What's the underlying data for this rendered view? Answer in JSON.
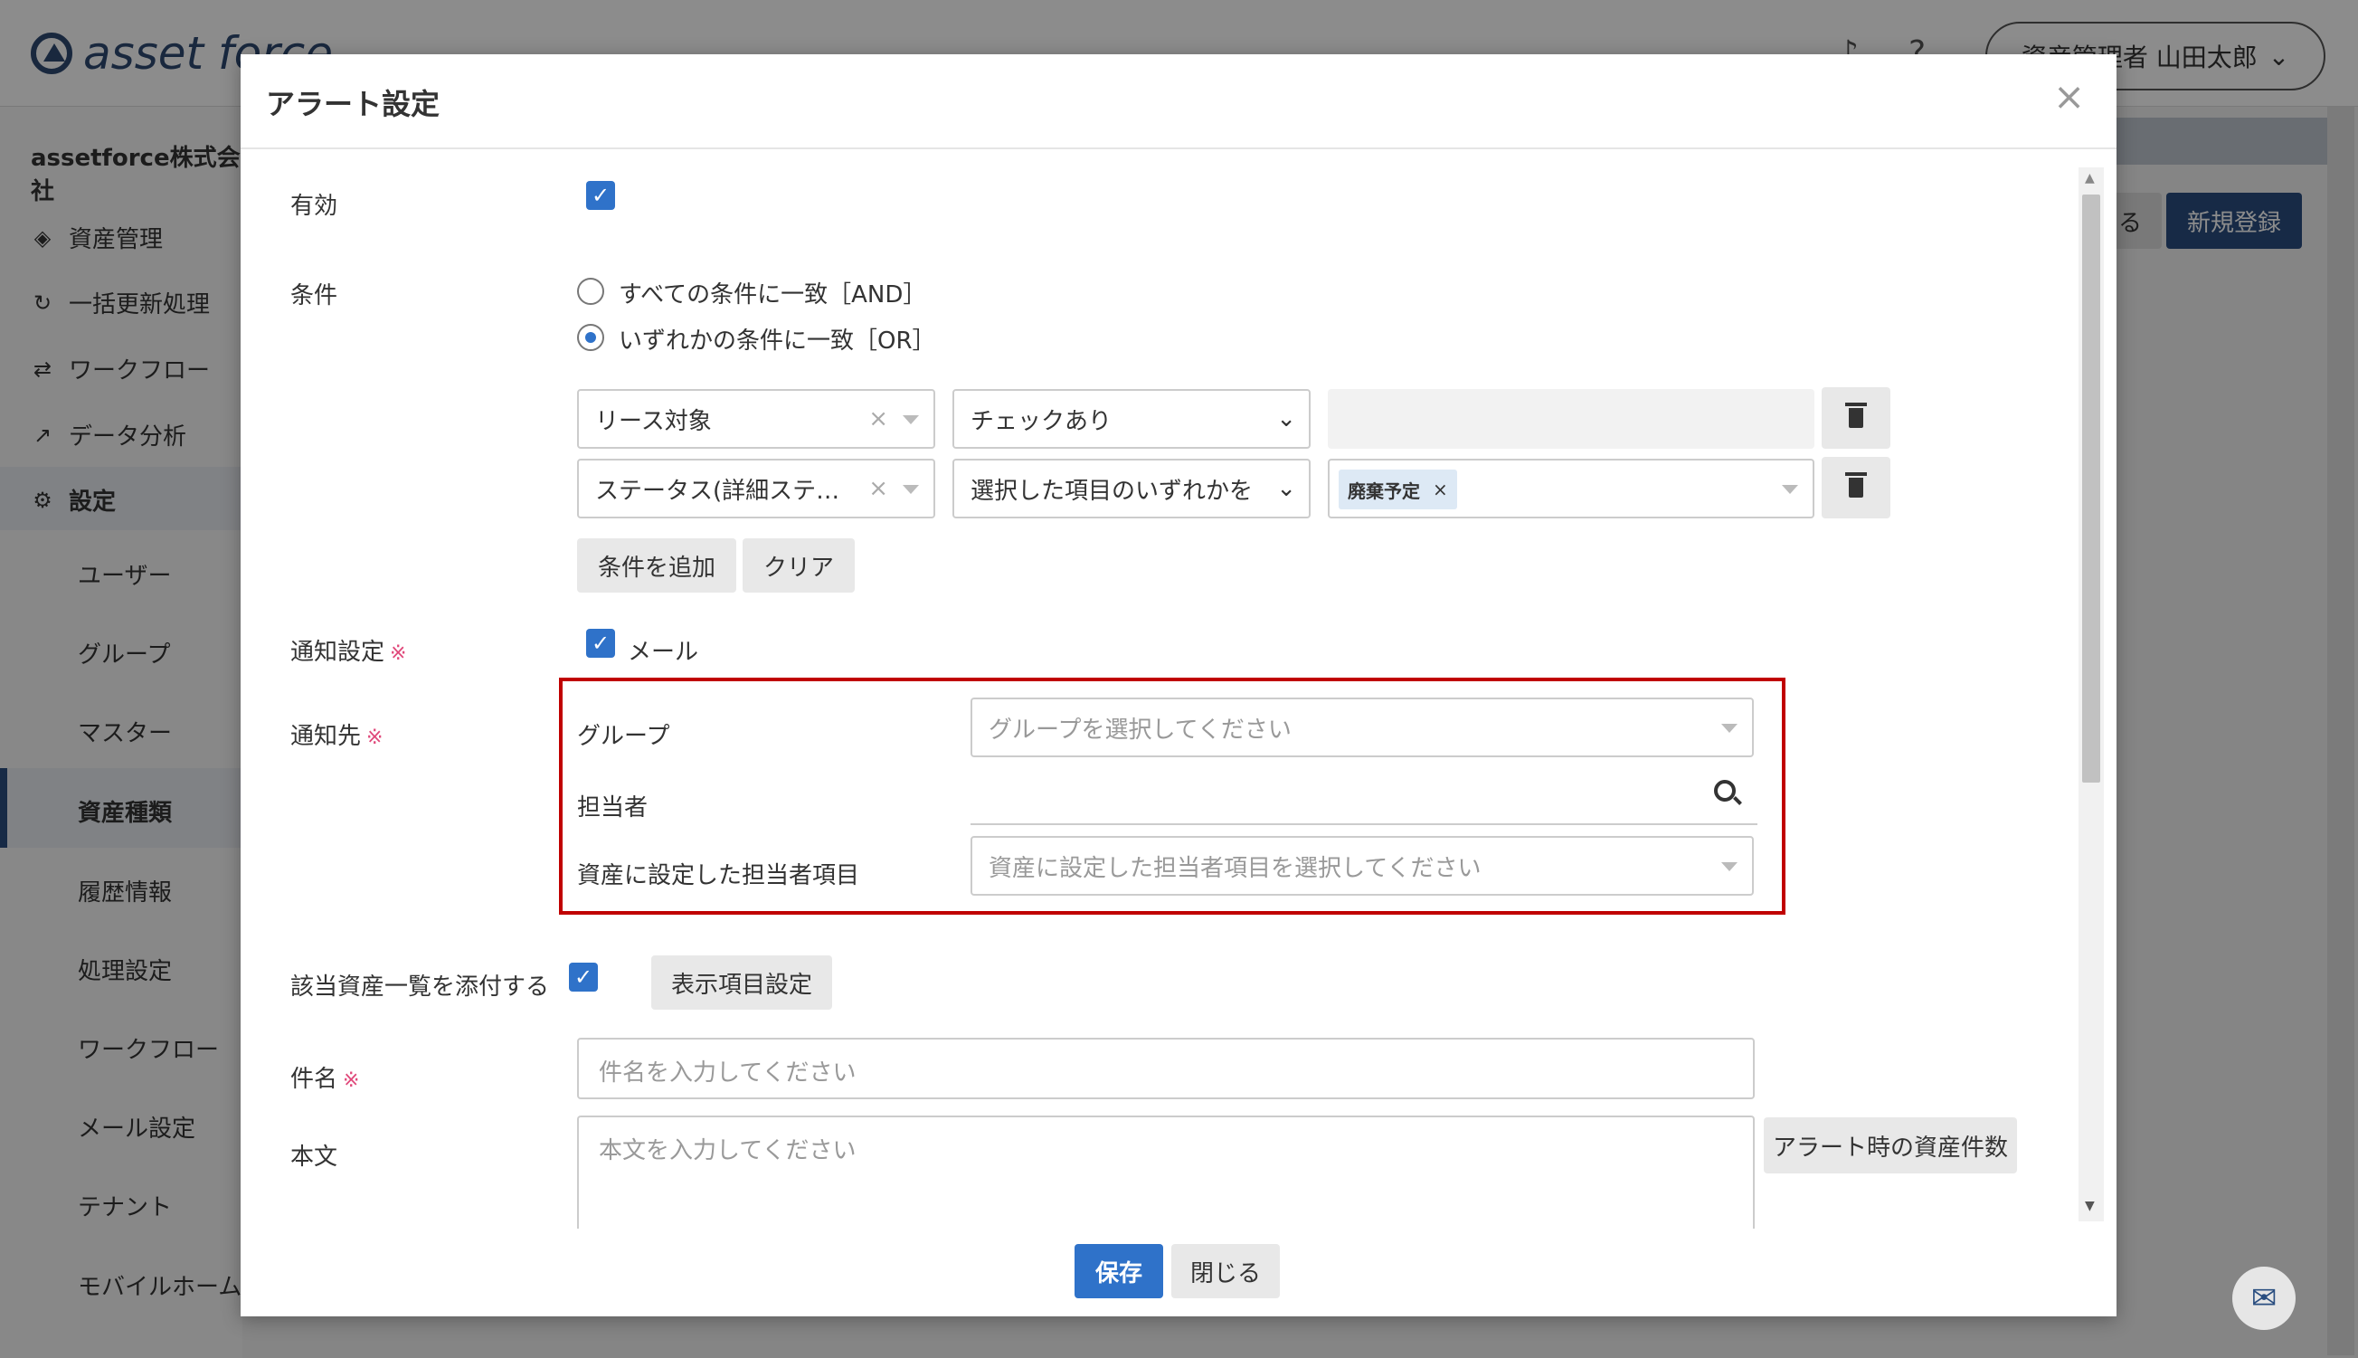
{
  "app": {
    "logo": "asset force",
    "user_label": "資産管理者 山田太郎",
    "company": "assetforce株式会社",
    "nav": [
      {
        "label": "資産管理",
        "icon": "cube-icon"
      },
      {
        "label": "一括更新処理",
        "icon": "refresh-icon"
      },
      {
        "label": "ワークフロー",
        "icon": "workflow-icon"
      },
      {
        "label": "データ分析",
        "icon": "chart-icon"
      },
      {
        "label": "設定",
        "icon": "gear-icon"
      }
    ],
    "subnav": [
      "ユーザー",
      "グループ",
      "マスター",
      "資産種類",
      "履歴情報",
      "処理設定",
      "ワークフロー",
      "メール設定",
      "テナント",
      "モバイルホーム"
    ],
    "bg_button_partial": "る",
    "bg_button_new": "新規登録"
  },
  "modal": {
    "title": "アラート設定",
    "close": "×",
    "enabled_label": "有効",
    "condition_label": "条件",
    "radio_and": "すべての条件に一致［AND］",
    "radio_or": "いずれかの条件に一致［OR］",
    "cond_rows": [
      {
        "field": "リース対象",
        "operator": "チェックあり"
      },
      {
        "field": "ステータス(詳細ステ…",
        "operator": "選択した項目のいずれかを",
        "tag": "廃棄予定"
      }
    ],
    "add_condition": "条件を追加",
    "clear": "クリア",
    "notify_setting_label": "通知設定",
    "notify_mail": "メール",
    "notify_to_label": "通知先",
    "required_mark": "※",
    "group_label": "グループ",
    "group_placeholder": "グループを選択してください",
    "person_label": "担当者",
    "asset_person_label": "資産に設定した担当者項目",
    "asset_person_placeholder": "資産に設定した担当者項目を選択してください",
    "attach_label": "該当資産一覧を添付する",
    "display_items": "表示項目設定",
    "subject_label": "件名",
    "subject_placeholder": "件名を入力してください",
    "body_label": "本文",
    "body_placeholder": "本文を入力してください",
    "alert_count_button": "アラート時の資産件数",
    "save": "保存",
    "close_button": "閉じる"
  }
}
